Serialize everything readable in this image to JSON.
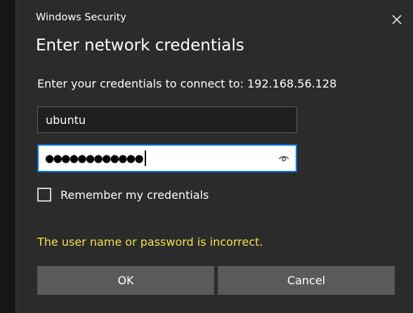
{
  "window": {
    "caption": "Windows Security",
    "close_icon": "close-icon"
  },
  "heading": "Enter network credentials",
  "connect_prompt": "Enter your credentials to connect to: 192.168.56.128",
  "username_field": {
    "value": "ubuntu"
  },
  "password_field": {
    "masked_value": "●●●●●●●●●●●●",
    "reveal_icon": "eye-icon"
  },
  "remember": {
    "label": "Remember my credentials",
    "checked": false
  },
  "error_message": "The user name or password is incorrect.",
  "buttons": {
    "ok_label": "OK",
    "cancel_label": "Cancel"
  },
  "colors": {
    "dialog_background": "#2b2b2b",
    "focus_border": "#0078d7",
    "error_text": "#f2e04a",
    "button_background": "#5a5a5a"
  }
}
